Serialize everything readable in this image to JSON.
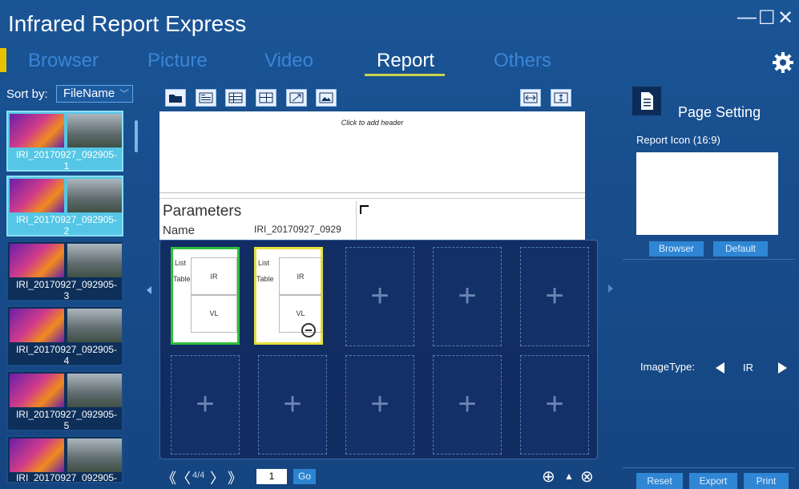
{
  "app": {
    "title": "Infrared Report Express"
  },
  "window_controls": {
    "minimize": "—",
    "maximize": "☐",
    "close": "✕"
  },
  "tabs": [
    {
      "label": "Browser",
      "active": false
    },
    {
      "label": "Picture",
      "active": false
    },
    {
      "label": "Video",
      "active": false
    },
    {
      "label": "Report",
      "active": true
    },
    {
      "label": "Others",
      "active": false
    }
  ],
  "sidebar": {
    "sort_label": "Sort by:",
    "sort_value": "FileName",
    "sort_chevron": "﹀",
    "items": [
      {
        "name": "IRI_20170927_092905-",
        "index": "1",
        "selected": true
      },
      {
        "name": "IRI_20170927_092905-",
        "index": "2",
        "selected": true
      },
      {
        "name": "IRI_20170927_092905-",
        "index": "3",
        "selected": false
      },
      {
        "name": "IRI_20170927_092905-",
        "index": "4",
        "selected": false
      },
      {
        "name": "IRI_20170927_092905-",
        "index": "5",
        "selected": false
      },
      {
        "name": "IRI_20170927_092905-",
        "index": "",
        "selected": false
      }
    ]
  },
  "toolbar": {
    "buttons": [
      "folder-icon",
      "text-block-icon",
      "list-table-icon",
      "grid-table-icon",
      "arrow-icon",
      "image-icon"
    ],
    "fit_buttons": [
      "fit-width-icon",
      "fit-height-icon"
    ]
  },
  "page": {
    "header_hint": "Click to add header",
    "params_title": "Parameters",
    "name_label": "Name",
    "name_value": "IRI_20170927_0929"
  },
  "templates": [
    {
      "list_label": "List",
      "table_label": "Table",
      "ir": "IR",
      "vl": "VL"
    },
    {
      "list_label": "List",
      "table_label": "Table",
      "ir": "IR",
      "vl": "VL"
    }
  ],
  "pager": {
    "first": "《",
    "prev": "〈",
    "info": "4/4",
    "next": "〉",
    "last": "》",
    "page_value": "1",
    "go_label": "Go",
    "zoom_in": "⊕",
    "collapse": "▲",
    "close": "⊗"
  },
  "right_panel": {
    "title": "Page Setting",
    "report_icon_label": "Report Icon (16:9)",
    "browser_button": "Browser",
    "default_button": "Default",
    "image_type_label": "ImageType:",
    "image_type_value": "IR",
    "reset_button": "Reset",
    "export_button": "Export",
    "print_button": "Print"
  },
  "colors": {
    "accent": "#c8d24a",
    "selected_green": "#2fbe3e",
    "selected_yellow": "#e6e13a",
    "panel_blue": "#184d8c"
  }
}
